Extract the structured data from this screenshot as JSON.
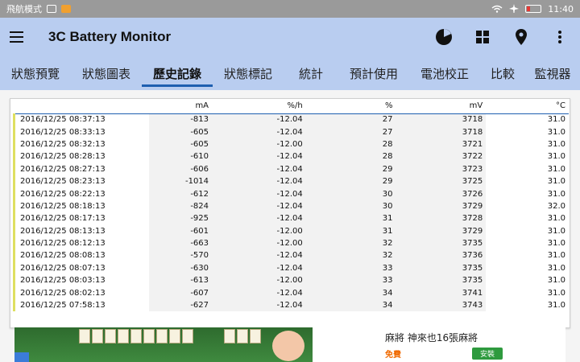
{
  "status_bar": {
    "left_text": "飛航模式",
    "time": "11:40"
  },
  "appbar": {
    "title": "3C Battery Monitor"
  },
  "tabs": [
    {
      "label": "狀態預覽"
    },
    {
      "label": "狀態圖表"
    },
    {
      "label": "歷史記錄"
    },
    {
      "label": "狀態標記"
    },
    {
      "label": "統計"
    },
    {
      "label": "預計使用"
    },
    {
      "label": "電池校正"
    },
    {
      "label": "比較"
    },
    {
      "label": "監視器"
    }
  ],
  "active_tab": "歷史記錄",
  "table": {
    "headers": [
      "",
      "mA",
      "%/h",
      "%",
      "mV",
      "°C"
    ],
    "rows": [
      [
        "2016/12/25 08:37:13",
        "-813",
        "-12.04",
        "27",
        "3718",
        "31.0"
      ],
      [
        "2016/12/25 08:33:13",
        "-605",
        "-12.04",
        "27",
        "3718",
        "31.0"
      ],
      [
        "2016/12/25 08:32:13",
        "-605",
        "-12.00",
        "28",
        "3721",
        "31.0"
      ],
      [
        "2016/12/25 08:28:13",
        "-610",
        "-12.04",
        "28",
        "3722",
        "31.0"
      ],
      [
        "2016/12/25 08:27:13",
        "-606",
        "-12.04",
        "29",
        "3723",
        "31.0"
      ],
      [
        "2016/12/25 08:23:13",
        "-1014",
        "-12.04",
        "29",
        "3725",
        "31.0"
      ],
      [
        "2016/12/25 08:22:13",
        "-612",
        "-12.04",
        "30",
        "3726",
        "31.0"
      ],
      [
        "2016/12/25 08:18:13",
        "-824",
        "-12.04",
        "30",
        "3729",
        "32.0"
      ],
      [
        "2016/12/25 08:17:13",
        "-925",
        "-12.04",
        "31",
        "3728",
        "31.0"
      ],
      [
        "2016/12/25 08:13:13",
        "-601",
        "-12.00",
        "31",
        "3729",
        "31.0"
      ],
      [
        "2016/12/25 08:12:13",
        "-663",
        "-12.00",
        "32",
        "3735",
        "31.0"
      ],
      [
        "2016/12/25 08:08:13",
        "-570",
        "-12.04",
        "32",
        "3736",
        "31.0"
      ],
      [
        "2016/12/25 08:07:13",
        "-630",
        "-12.04",
        "33",
        "3735",
        "31.0"
      ],
      [
        "2016/12/25 08:03:13",
        "-613",
        "-12.00",
        "33",
        "3735",
        "31.0"
      ],
      [
        "2016/12/25 08:02:13",
        "-607",
        "-12.04",
        "34",
        "3741",
        "31.0"
      ],
      [
        "2016/12/25 07:58:13",
        "-627",
        "-12.04",
        "34",
        "3743",
        "31.0"
      ]
    ]
  },
  "ad": {
    "title": "麻將 神來也16張麻將",
    "free_label": "免費",
    "install_label": "安裝"
  },
  "colors": {
    "appbar": "#b9cdf0",
    "accent": "#1e5fb0",
    "row_marker": "#dfe060"
  }
}
